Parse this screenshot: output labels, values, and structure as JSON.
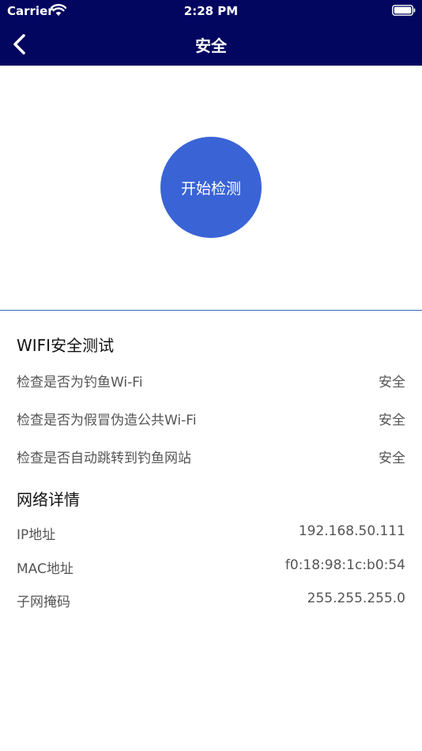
{
  "status_bar": {
    "carrier": "Carrier",
    "time": "2:28 PM"
  },
  "nav": {
    "title": "安全"
  },
  "detect": {
    "button_label": "开始检测"
  },
  "wifi_section": {
    "title": "WIFI安全测试",
    "items": [
      {
        "label": "检查是否为钓鱼Wi-Fi",
        "value": "安全"
      },
      {
        "label": "检查是否为假冒伪造公共Wi-Fi",
        "value": "安全"
      },
      {
        "label": "检查是否自动跳转到钓鱼网站",
        "value": "安全"
      }
    ]
  },
  "network_section": {
    "title": "网络详情",
    "items": [
      {
        "label": "IP地址",
        "value": "192.168.50.111"
      },
      {
        "label": "MAC地址",
        "value": "f0:18:98:1c:b0:54"
      },
      {
        "label": "子网掩码",
        "value": "255.255.255.0"
      }
    ]
  },
  "colors": {
    "header": "#02065f",
    "accent": "#3a63d6"
  }
}
